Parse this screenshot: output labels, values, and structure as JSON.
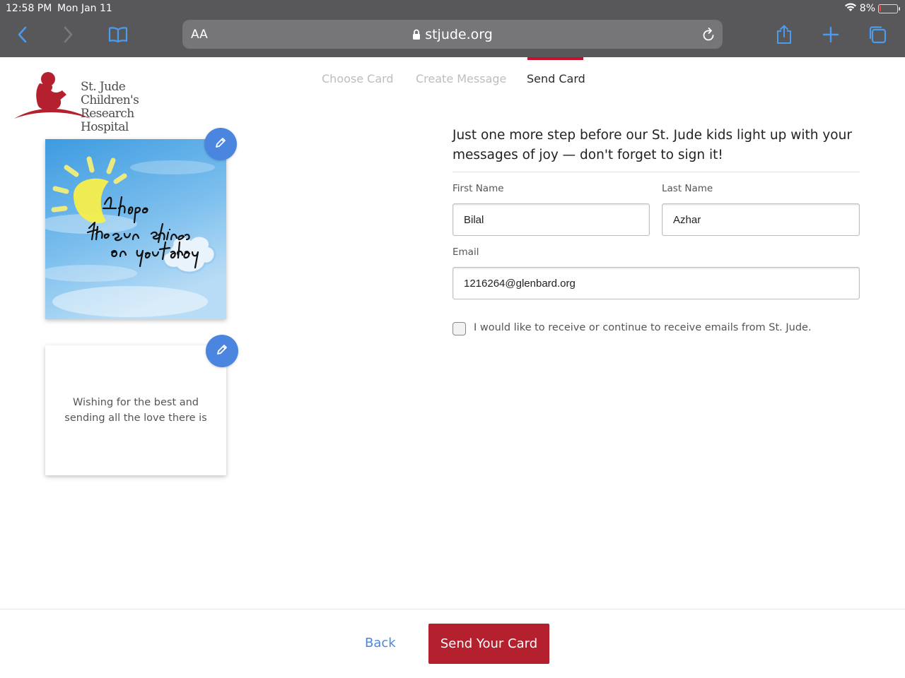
{
  "status_bar": {
    "time": "12:58 PM",
    "date": "Mon Jan 11",
    "battery": "8%"
  },
  "browser": {
    "text_size_label": "AA",
    "url": "stjude.org"
  },
  "icons": [
    "back-icon",
    "forward-icon",
    "bookmarks-icon",
    "lock-icon",
    "reload-icon",
    "share-icon",
    "new-tab-icon",
    "tabs-icon",
    "wifi-icon",
    "battery-icon",
    "pencil-icon"
  ],
  "logo": {
    "line1": "St. Jude Children's",
    "line2": "Research Hospital"
  },
  "steps": [
    {
      "label": "Choose Card",
      "active": false
    },
    {
      "label": "Create Message",
      "active": false
    },
    {
      "label": "Send Card",
      "active": true
    }
  ],
  "card": {
    "front_text": [
      "I hope",
      "the sun shines",
      "on you today"
    ],
    "back_message": "Wishing for the best and sending all the love there is"
  },
  "form": {
    "headline": "Just one more step before our St. Jude kids light up with your messages of joy — don't forget to sign it!",
    "first_name_label": "First Name",
    "first_name_value": "Bilal",
    "last_name_label": "Last Name",
    "last_name_value": "Azhar",
    "email_label": "Email",
    "email_value": "1216264@glenbard.org",
    "opt_in_label": "I would like to receive or continue to receive emails from St. Jude.",
    "opt_in_checked": false
  },
  "footer": {
    "back_label": "Back",
    "send_label": "Send Your Card"
  },
  "colors": {
    "brand_red": "#b5202f",
    "link_blue": "#4a86e0",
    "chrome_gray": "#58585a"
  }
}
